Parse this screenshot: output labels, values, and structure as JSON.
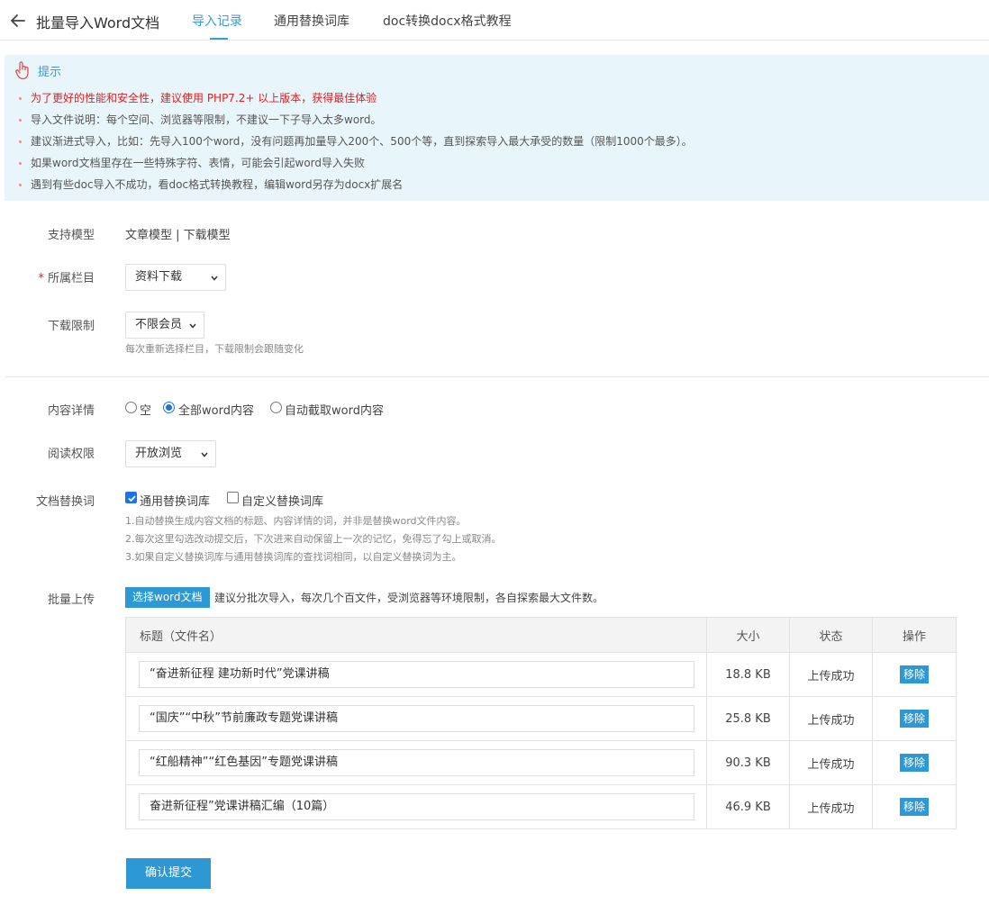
{
  "header": {
    "title": "批量导入Word文档",
    "tabs": [
      "导入记录",
      "通用替换词库",
      "doc转换docx格式教程"
    ],
    "active_tab": 0
  },
  "tip": {
    "title": "提示",
    "lines": [
      "为了更好的性能和安全性，建议使用 PHP7.2+ 以上版本，获得最佳体验",
      "导入文件说明：每个空间、浏览器等限制，不建议一下子导入太多word。",
      "建议渐进式导入，比如：先导入100个word，没有问题再加量导入200个、500个等，直到探索导入最大承受的数量（限制1000个最多）。",
      "如果word文档里存在一些特殊字符、表情，可能会引起word导入失败",
      "遇到有些doc导入不成功，看doc格式转换教程，编辑word另存为docx扩展名"
    ]
  },
  "form": {
    "model": {
      "label": "支持模型",
      "value": "文章模型 | 下载模型"
    },
    "column": {
      "required_mark": "*",
      "label": "所属栏目",
      "selected": "资料下载"
    },
    "download_limit": {
      "label": "下载限制",
      "selected": "不限会员",
      "hint": "每次重新选择栏目，下载限制会跟随变化"
    },
    "content_detail": {
      "label": "内容详情",
      "options": [
        "空",
        "全部word内容",
        "自动截取word内容"
      ],
      "selected_index": 1
    },
    "read_permission": {
      "label": "阅读权限",
      "selected": "开放浏览"
    },
    "replace_dict": {
      "label": "文档替换词",
      "options": [
        {
          "label": "通用替换词库",
          "checked": true
        },
        {
          "label": "自定义替换词库",
          "checked": false
        }
      ],
      "notes": [
        "1.自动替换生成内容文档的标题、内容详情的词，并非是替换word文件内容。",
        "2.每次这里勾选改动提交后，下次进来自动保留上一次的记忆，免得忘了勾上或取消。",
        "3.如果自定义替换词库与通用替换词库的查找词相同，以自定义替换词为主。"
      ]
    },
    "batch_upload": {
      "label": "批量上传",
      "button": "选择word文档",
      "hint": "建议分批次导入，每次几个百文件，受浏览器等环境限制，各自探索最大文件数。"
    }
  },
  "table": {
    "headers": [
      "标题（文件名）",
      "大小",
      "状态",
      "操作"
    ],
    "rows": [
      {
        "title": "“奋进新征程 建功新时代”党课讲稿",
        "size": "18.8 KB",
        "status": "上传成功",
        "action": "移除"
      },
      {
        "title": "“国庆”“中秋”节前廉政专题党课讲稿",
        "size": "25.8 KB",
        "status": "上传成功",
        "action": "移除"
      },
      {
        "title": "“红船精神”“红色基因”专题党课讲稿",
        "size": "90.3 KB",
        "status": "上传成功",
        "action": "移除"
      },
      {
        "title": "奋进新征程”党课讲稿汇编（10篇）",
        "size": "46.9 KB",
        "status": "上传成功",
        "action": "移除"
      }
    ]
  },
  "submit_label": "确认提交",
  "colors": {
    "accent": "#3a9bd8",
    "button": "#2d98d4",
    "success": "#5cb85c",
    "warn": "#e02020",
    "tip_bg": "#e8f5fb"
  },
  "icons": {
    "back": "arrow-left-icon",
    "tip": "hand-pointer-icon",
    "select": "chevron-down-icon"
  }
}
